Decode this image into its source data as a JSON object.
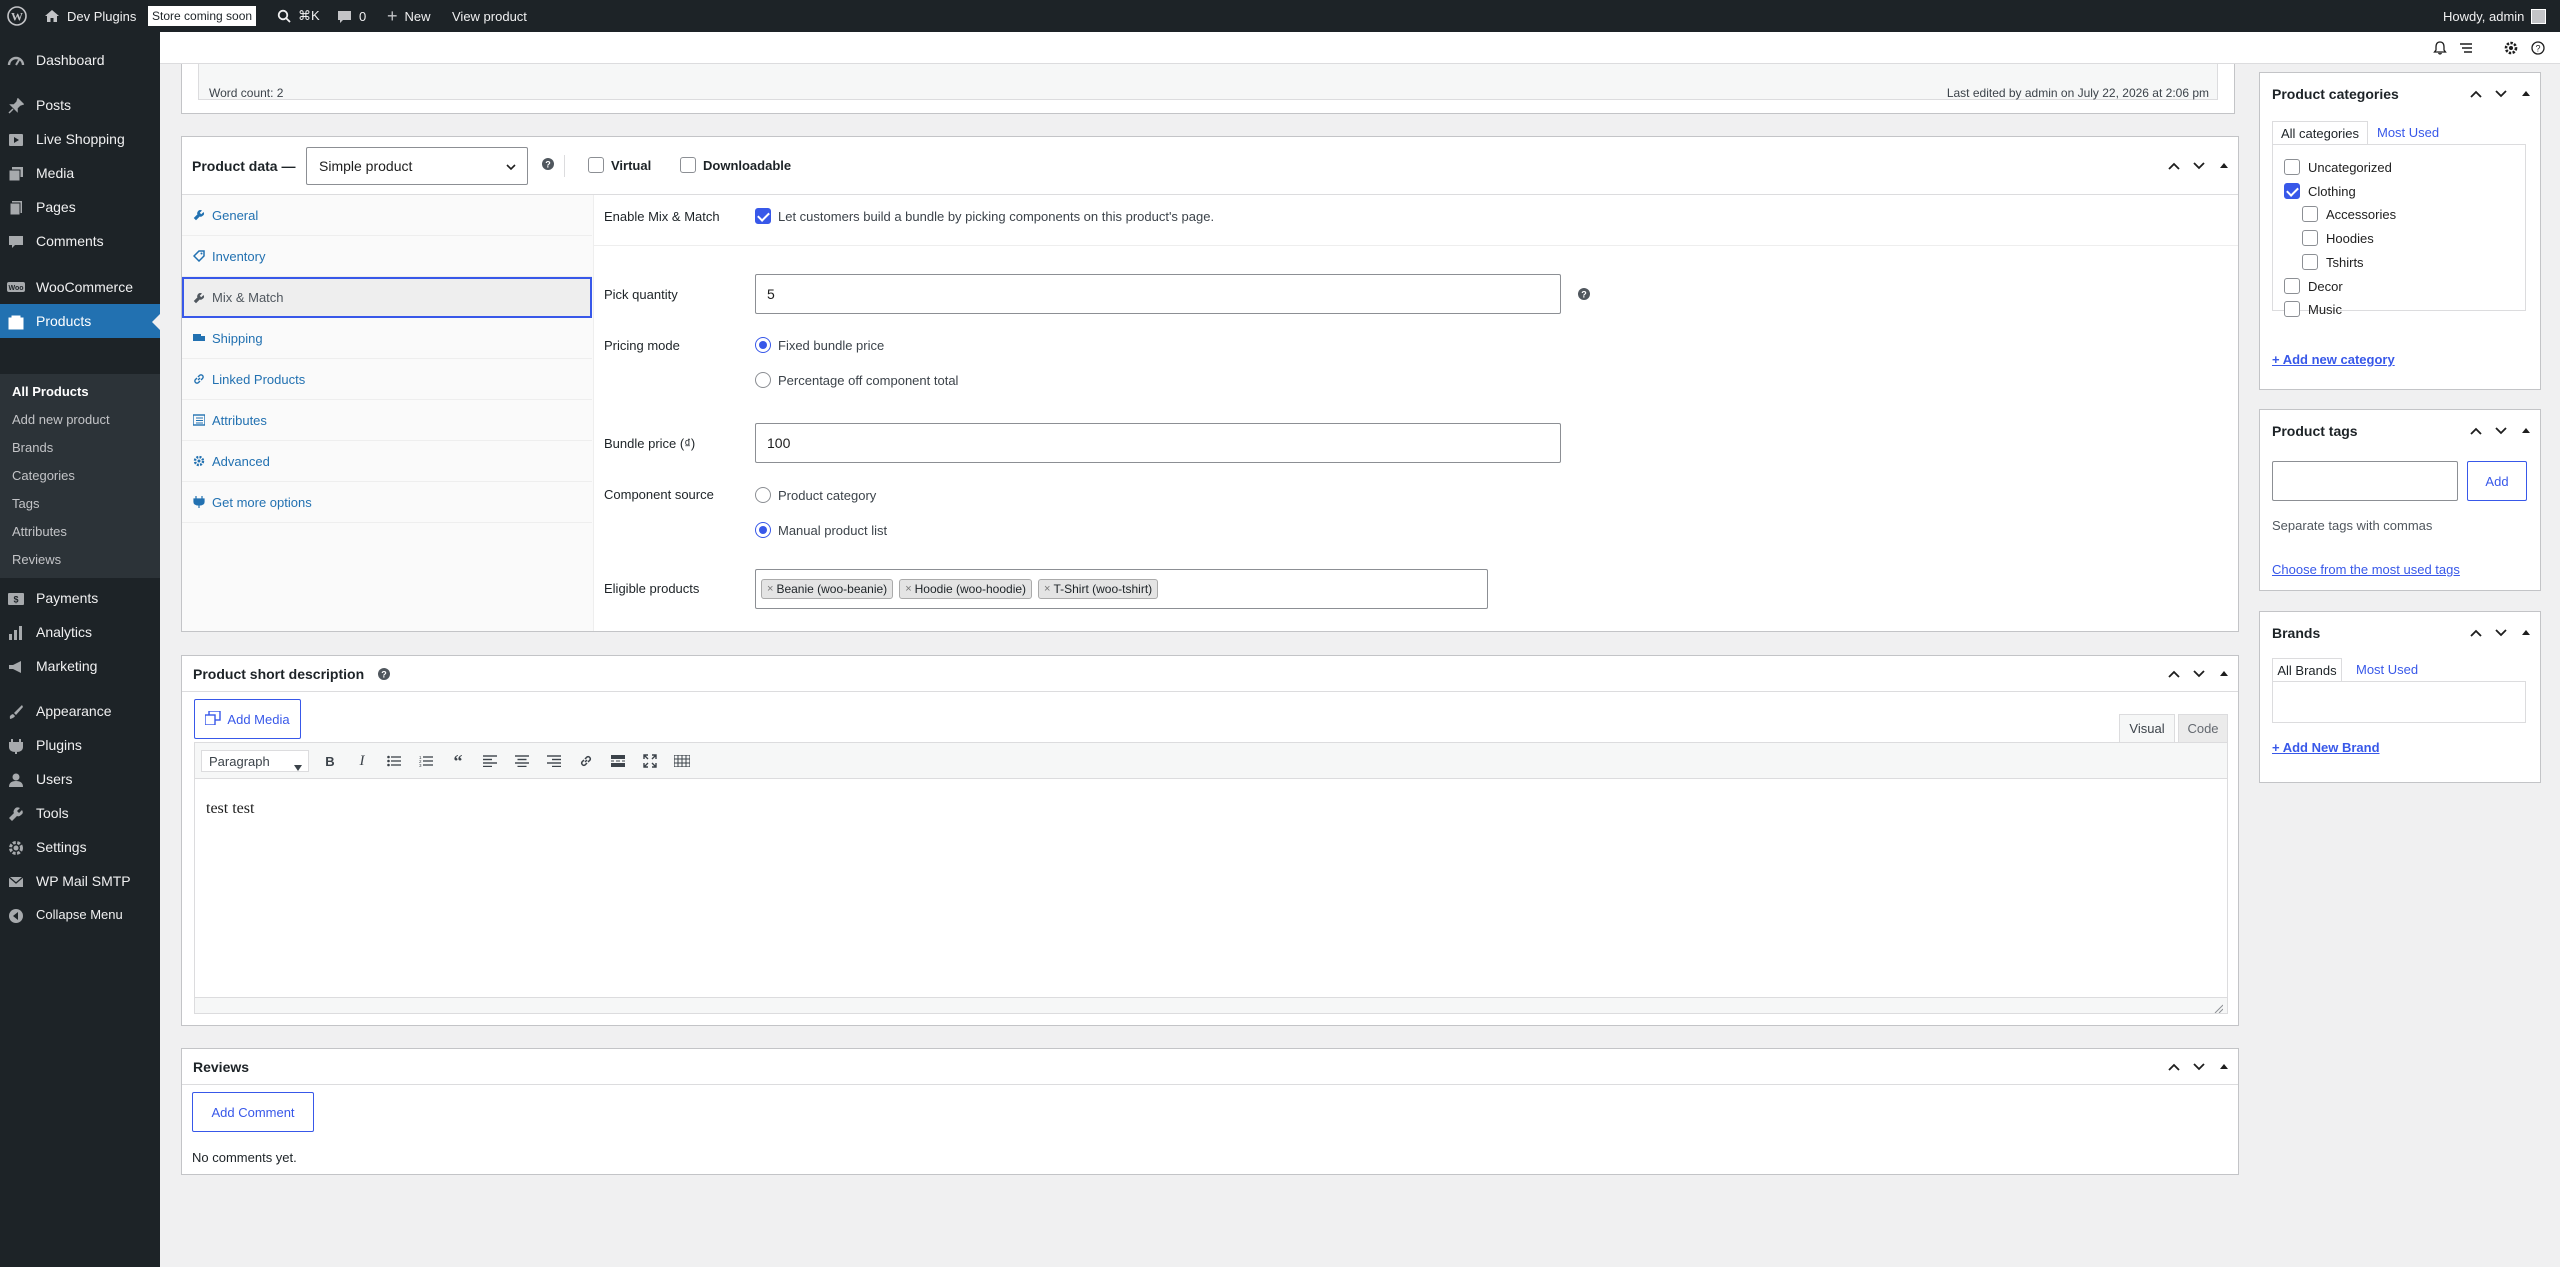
{
  "adminbar": {
    "site_name": "Dev Plugins",
    "store_badge": "Store coming soon",
    "shortcut": "⌘K",
    "comments_count": "0",
    "new_label": "New",
    "view_product": "View product",
    "greeting": "Howdy, admin"
  },
  "sidebar": {
    "dashboard": "Dashboard",
    "posts": "Posts",
    "live_shopping": "Live Shopping",
    "media": "Media",
    "pages": "Pages",
    "comments": "Comments",
    "woocommerce": "WooCommerce",
    "products": "Products",
    "sub": [
      "All Products",
      "Add new product",
      "Brands",
      "Categories",
      "Tags",
      "Attributes",
      "Reviews"
    ],
    "payments": "Payments",
    "analytics": "Analytics",
    "marketing": "Marketing",
    "appearance": "Appearance",
    "plugins": "Plugins",
    "users": "Users",
    "tools": "Tools",
    "settings": "Settings",
    "wp_mail_smtp": "WP Mail SMTP",
    "collapse": "Collapse Menu"
  },
  "editor_footer": {
    "word_count": "Word count: 2",
    "last_edited": "Last edited by admin on July 22, 2026 at 2:06 pm"
  },
  "product_data": {
    "title": "Product data —",
    "type_select": "Simple product",
    "virtual": "Virtual",
    "downloadable": "Downloadable",
    "tabs": [
      "General",
      "Inventory",
      "Mix & Match",
      "Shipping",
      "Linked Products",
      "Attributes",
      "Advanced",
      "Get more options"
    ],
    "enable_label": "Enable Mix & Match",
    "enable_desc": "Let customers build a bundle by picking components on this product's page.",
    "pick_qty_label": "Pick quantity",
    "pick_qty_value": "5",
    "pricing_mode_label": "Pricing mode",
    "pricing_fixed": "Fixed bundle price",
    "pricing_percent": "Percentage off component total",
    "bundle_price_label": "Bundle price (₫)",
    "bundle_price_value": "100",
    "component_source_label": "Component source",
    "source_category": "Product category",
    "source_manual": "Manual product list",
    "eligible_label": "Eligible products",
    "eligible_tokens": [
      "Beanie (woo-beanie)",
      "Hoodie (woo-hoodie)",
      "T-Shirt (woo-tshirt)"
    ]
  },
  "short_desc": {
    "title": "Product short description",
    "add_media": "Add Media",
    "tab_visual": "Visual",
    "tab_code": "Code",
    "format": "Paragraph",
    "content": "test test"
  },
  "reviews": {
    "title": "Reviews",
    "add_comment": "Add Comment",
    "empty": "No comments yet."
  },
  "categories": {
    "title": "Product categories",
    "tab_all": "All categories",
    "tab_most": "Most Used",
    "items": [
      "Uncategorized",
      "Clothing",
      "Accessories",
      "Hoodies",
      "Tshirts",
      "Decor",
      "Music"
    ],
    "add_new": "+ Add new category"
  },
  "tags": {
    "title": "Product tags",
    "add": "Add",
    "hint": "Separate tags with commas",
    "choose": "Choose from the most used tags"
  },
  "brands": {
    "title": "Brands",
    "tab_all": "All Brands",
    "tab_most": "Most Used",
    "add_new": "+ Add New Brand"
  },
  "colors": {
    "accent": "#3858e9",
    "link": "#2271b1",
    "admin_bg": "#1d2327",
    "menu_current": "#2271b1"
  }
}
